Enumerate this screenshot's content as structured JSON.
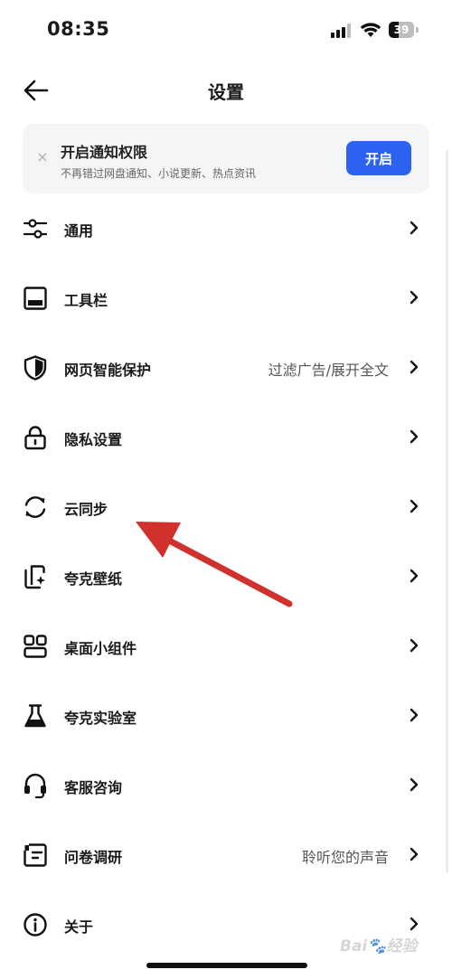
{
  "status_bar": {
    "time": "08:35",
    "battery": 39
  },
  "nav": {
    "title": "设置"
  },
  "notice": {
    "close": "×",
    "title": "开启通知权限",
    "subtitle": "不再错过网盘通知、小说更新、热点资讯",
    "button": "开启"
  },
  "menu": {
    "items": [
      {
        "label": "通用",
        "hint": "",
        "icon": "sliders-icon"
      },
      {
        "label": "工具栏",
        "hint": "",
        "icon": "toolbar-icon"
      },
      {
        "label": "网页智能保护",
        "hint": "过滤广告/展开全文",
        "icon": "shield-icon"
      },
      {
        "label": "隐私设置",
        "hint": "",
        "icon": "lock-icon"
      },
      {
        "label": "云同步",
        "hint": "",
        "icon": "sync-icon"
      },
      {
        "label": "夸克壁纸",
        "hint": "",
        "icon": "wallpaper-icon"
      },
      {
        "label": "桌面小组件",
        "hint": "",
        "icon": "widgets-icon"
      },
      {
        "label": "夸克实验室",
        "hint": "",
        "icon": "flask-icon"
      },
      {
        "label": "客服咨询",
        "hint": "",
        "icon": "headset-icon"
      },
      {
        "label": "问卷调研",
        "hint": "聆听您的声音",
        "icon": "survey-icon"
      },
      {
        "label": "关于",
        "hint": "",
        "icon": "info-icon"
      }
    ]
  },
  "watermark": "Bai🐾经验",
  "colors": {
    "accent": "#2b63f0",
    "annotation": "#d0312d"
  }
}
